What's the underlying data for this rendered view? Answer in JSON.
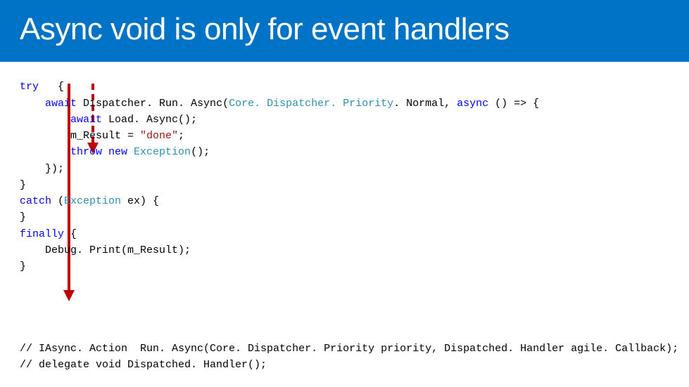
{
  "header": {
    "title": "Async void is only for event handlers"
  },
  "code": {
    "line1_try": "try",
    "line1_brace": "   {",
    "line2_await": "await",
    "line2_rest": " Dispatcher. Run. Async(",
    "line2_type": "Core. Dispatcher. Priority",
    "line2_dot": ". Normal, ",
    "line2_async": "async",
    "line2_tail": " () => {",
    "line3_indent": "        ",
    "line3_await": "await",
    "line3_rest": " Load. Async();",
    "line4": "        m_Result = ",
    "line4_str": "\"done\"",
    "line4_semi": ";",
    "line5_indent": "        ",
    "line5_throw": "throw",
    "line5_new": " new",
    "line5_type": " Exception",
    "line5_tail": "();",
    "line6": "    });",
    "line7": "}",
    "line8_catch": "catch",
    "line8_paren": " (",
    "line8_type": "Exception",
    "line8_rest": " ex) {",
    "line9": "}",
    "line10_finally": "finally",
    "line10_brace": " {",
    "line11": "    Debug. Print(m_Result);",
    "line12": "}"
  },
  "footer": {
    "line1": "// IAsync. Action  Run. Async(Core. Dispatcher. Priority priority, Dispatched. Handler agile. Callback);",
    "line2": "// delegate void Dispatched. Handler();"
  },
  "colors": {
    "header_bg": "#0173c7",
    "keyword": "#0000ff",
    "type": "#2b91af",
    "string": "#a31515",
    "comment": "#008000",
    "arrow": "#c00000"
  }
}
